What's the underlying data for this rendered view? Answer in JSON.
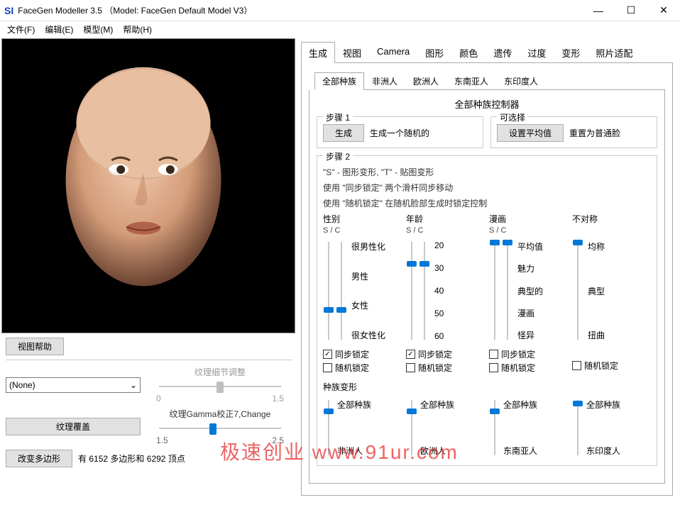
{
  "window": {
    "app_icon": "SI",
    "title": "FaceGen Modeller 3.5 （Model: FaceGen Default Model V3）"
  },
  "menu": {
    "file": "文件(F)",
    "edit": "编辑(E)",
    "model": "模型(M)",
    "help": "帮助(H)"
  },
  "left_panel": {
    "view_help_btn": "视图帮助",
    "texture_select": "(None)",
    "texture_detail_label": "纹理细节调整",
    "texture_detail_min": "0",
    "texture_detail_max": "1.5",
    "gamma_label": "纹理Gamma校正7,Change",
    "gamma_min": "1.5",
    "gamma_max": "2.5",
    "texture_override_btn": "纹理覆盖",
    "change_poly_btn": "改变多边形",
    "poly_info_1": "有",
    "poly_info_2": "6152",
    "poly_info_3": "多边形和",
    "poly_info_4": "6292",
    "poly_info_5": "顶点"
  },
  "main_tabs": [
    "生成",
    "视图",
    "Camera",
    "图形",
    "颜色",
    "遗传",
    "过度",
    "变形",
    "照片适配"
  ],
  "sub_tabs": [
    "全部种族",
    "非洲人",
    "欧洲人",
    "东南亚人",
    "东印度人"
  ],
  "section_title": "全部种族控制器",
  "step1": {
    "title": "步骤 1",
    "generate_btn": "生成",
    "generate_desc": "生成一个随机的"
  },
  "optional": {
    "title": "可选择",
    "set_avg_btn": "设置平均值",
    "reset_desc": "重置为普通脸"
  },
  "step2": {
    "title": "步骤 2",
    "info1": "\"S\" - 图形变形, \"T\" - 贴图变形",
    "info2": "使用 \"同步锁定\" 两个滑杆同步移动",
    "info3": "使用 \"随机锁定\" 在随机脸部生成时锁定控制"
  },
  "sliders": {
    "gender": {
      "head": "性别",
      "sub": "S / C",
      "labels": [
        "很男性化",
        "男性",
        "女性",
        "很女性化"
      ]
    },
    "age": {
      "head": "年龄",
      "sub": "S / C",
      "labels": [
        "20",
        "30",
        "40",
        "50",
        "60"
      ]
    },
    "cartoon": {
      "head": "漫画",
      "sub": "S / C",
      "labels": [
        "平均值",
        "魅力",
        "典型的",
        "漫画",
        "怪异"
      ]
    },
    "asym": {
      "head": "不对称",
      "sub": "",
      "labels": [
        "均称",
        "典型",
        "扭曲"
      ]
    }
  },
  "checks": {
    "sync_lock": "同步锁定",
    "random_lock": "随机锁定"
  },
  "race_morph": {
    "title": "种族变形",
    "labels_top": "全部种族",
    "labels_bottom": [
      "非洲人",
      "欧洲人",
      "东南亚人",
      "东印度人"
    ]
  },
  "watermark": "极速创业 www.91ur.com"
}
